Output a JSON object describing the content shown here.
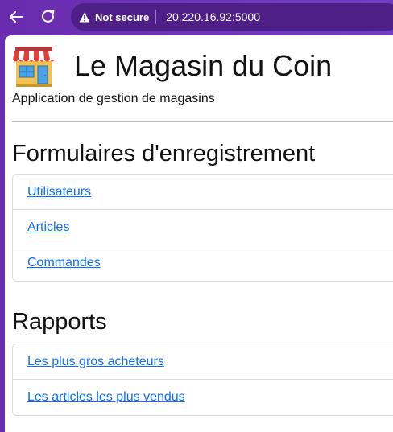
{
  "browser": {
    "security_label": "Not secure",
    "url": "20.220.16.92:5000",
    "icons": [
      "back-arrow-icon",
      "reload-icon",
      "warning-icon"
    ]
  },
  "header": {
    "icon": "store-icon",
    "title": "Le Magasin du Coin",
    "subtitle": "Application de gestion de magasins"
  },
  "forms": {
    "title": "Formulaires d'enregistrement",
    "items": [
      {
        "label": "Utilisateurs"
      },
      {
        "label": "Articles"
      },
      {
        "label": "Commandes"
      }
    ]
  },
  "reports": {
    "title": "Rapports",
    "items": [
      {
        "label": "Les plus gros acheteurs"
      },
      {
        "label": "Les articles les plus vendus"
      }
    ]
  },
  "colors": {
    "chrome": "#6b33b8",
    "address_bar": "#4e1f86",
    "link": "#0d6efd"
  }
}
